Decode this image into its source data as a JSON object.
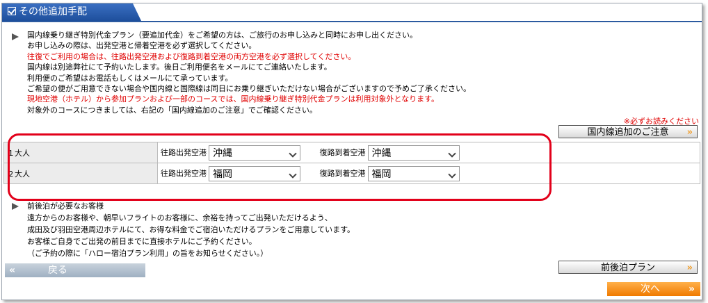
{
  "section": {
    "title": "その他追加手配"
  },
  "notice": {
    "lines": [
      {
        "text": "国内線乗り継ぎ特別代金プラン（要追加代金）をご希望の方は、ご旅行のお申し込みと同時にお申し出ください。",
        "red": false
      },
      {
        "text": "お申し込みの際は、出発空港と帰着空港を必ず選択してください。",
        "red": false
      },
      {
        "text": "往復でご利用の場合は、往路出発空港および復路到着空港の両方空港を必ず選択してください。",
        "red": true
      },
      {
        "text": "国内線は別途弊社にて予約いたします。後日ご利用便名をメールにてご連絡いたします。",
        "red": false
      },
      {
        "text": "利用便のご希望はお電話もしくはメールにて承っています。",
        "red": false
      },
      {
        "text": "ご希望の便がご用意できない場合や国内線と国際線は同日にお乗り継ぎいただけない場合がございますので予めご了承ください。",
        "red": false
      },
      {
        "text": "現地空港（ホテル）から参加プランおよび一部のコースでは、国内線乗り継ぎ特別代金プランは利用対象外となります。",
        "red": true
      },
      {
        "text": "対象外のコースにつきましては、右記の「国内線追加のご注意」でご確認ください。",
        "red": false
      }
    ],
    "must_read": "※必ずお読みください",
    "caution_button": "国内線追加のご注意",
    "chevron": "»"
  },
  "passengers": [
    {
      "label": "１大人",
      "departure_label": "往路出発空港",
      "departure_value": "沖縄",
      "arrival_label": "復路到着空港",
      "arrival_value": "沖縄"
    },
    {
      "label": "２大人",
      "departure_label": "往路出発空港",
      "departure_value": "福岡",
      "arrival_label": "復路到着空港",
      "arrival_value": "福岡"
    }
  ],
  "pre_post": {
    "title": "前後泊が必要なお客様",
    "lines": [
      "遠方からのお客様や、朝早いフライトのお客様に、余裕を持ってご出発いただけるよう、",
      "成田及び羽田空港周辺ホテルにて、お得な料金でご宿泊いただけるプランをご用意しています。",
      "お客様ご自身でご出発の前日までに直接ホテルにご予約ください。",
      "（ご予約の際に「ハロー宿泊プラン利用」の旨をお知らせください。）"
    ],
    "button": "前後泊プラン"
  },
  "nav": {
    "back": "戻る",
    "next": "次へ",
    "back_chevron": "«",
    "next_chevron": "»"
  },
  "colors": {
    "tab": "#2c5aa0",
    "red": "#e00000",
    "highlight": "#e2001a",
    "next": "#f07a00"
  }
}
